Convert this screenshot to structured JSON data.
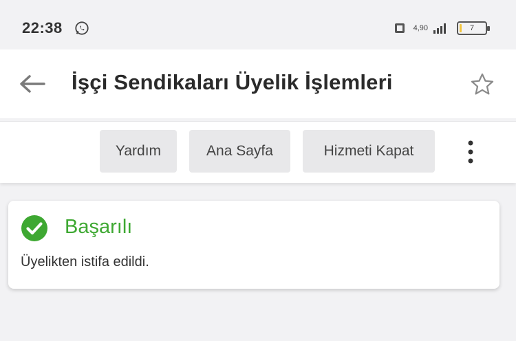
{
  "status_bar": {
    "time": "22:38",
    "network_label": "4,90",
    "battery_level": "7",
    "battery_fraction": 0.07,
    "icons": [
      "whatsapp-icon",
      "network-data-icon",
      "signal-icon",
      "battery-icon"
    ]
  },
  "header": {
    "title": "İşçi Sendikaları Üyelik İşlemleri",
    "back_icon": "arrow-left-icon",
    "favorite_icon": "star-outline-icon"
  },
  "toolbar": {
    "help_label": "Yardım",
    "home_label": "Ana Sayfa",
    "close_service_label": "Hizmeti Kapat",
    "more_icon": "kebab-menu-icon"
  },
  "result": {
    "status_title": "Başarılı",
    "message": "Üyelikten istifa edildi.",
    "status_color": "#3ea832",
    "icon": "check-circle-icon"
  },
  "colors": {
    "background": "#f2f2f4",
    "surface": "#ffffff",
    "button_bg": "#e8e8ea",
    "success": "#3ea832"
  }
}
